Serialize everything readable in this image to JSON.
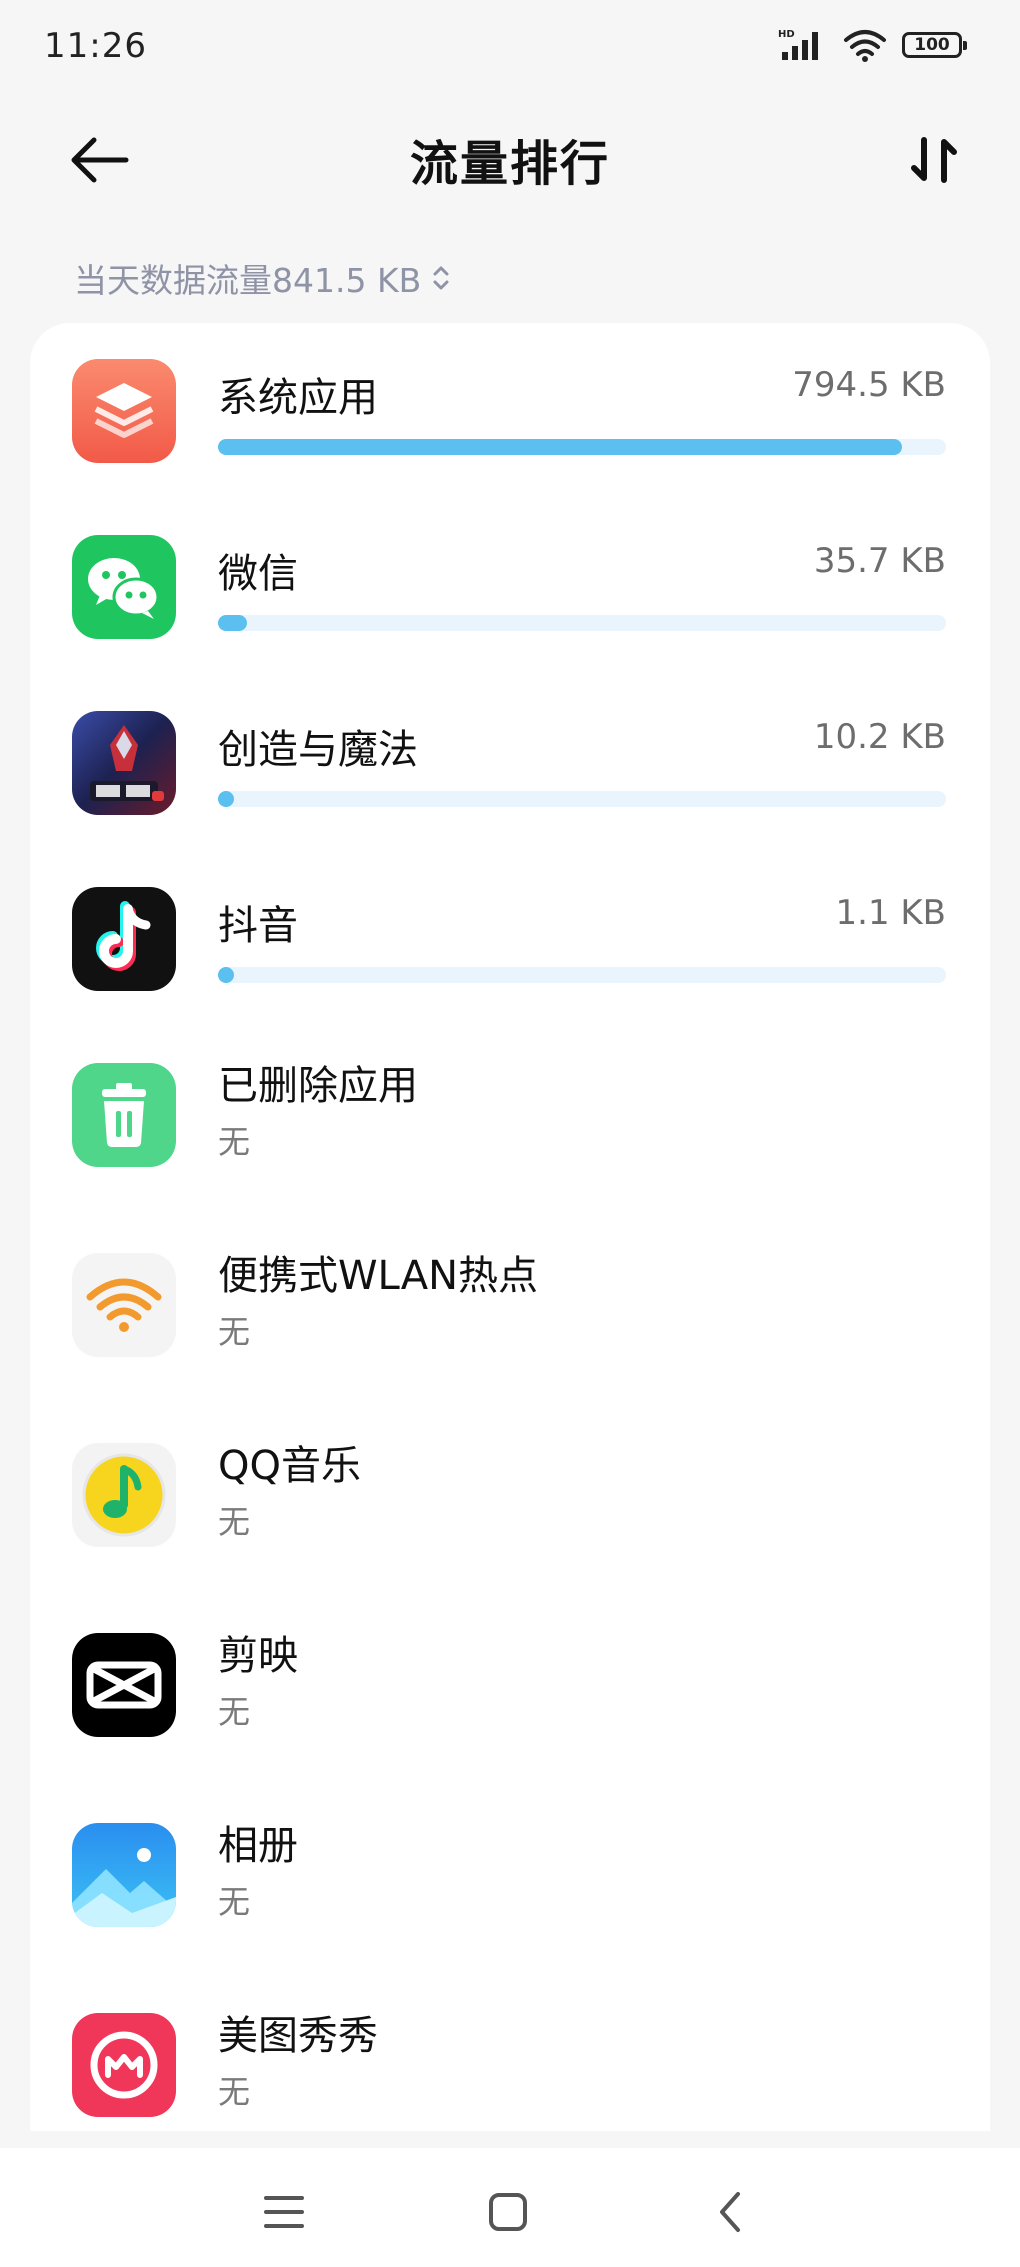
{
  "status_bar": {
    "time": "11:26",
    "battery": "100",
    "network": "HD"
  },
  "header": {
    "title": "流量排行"
  },
  "summary": {
    "label": "当天数据流量841.5 KB"
  },
  "apps": [
    {
      "name": "系统应用",
      "size": "794.5 KB",
      "usage_fraction": 0.94,
      "icon": "system-apps-icon",
      "color": "#f46a54"
    },
    {
      "name": "微信",
      "size": "35.7 KB",
      "usage_fraction": 0.04,
      "icon": "wechat-icon",
      "color": "#1fc660"
    },
    {
      "name": "创造与魔法",
      "size": "10.2 KB",
      "usage_fraction": 0.012,
      "icon": "game-icon",
      "color": "#2a2f6e"
    },
    {
      "name": "抖音",
      "size": "1.1 KB",
      "usage_fraction": 0.001,
      "icon": "douyin-icon",
      "color": "#111111"
    },
    {
      "name": "已删除应用",
      "sub": "无",
      "icon": "trash-icon",
      "color": "#4fd68a"
    },
    {
      "name": "便携式WLAN热点",
      "sub": "无",
      "icon": "wifi-hotspot-icon",
      "color": "#f5f5f5"
    },
    {
      "name": "QQ音乐",
      "sub": "无",
      "icon": "qq-music-icon",
      "color": "#f7d51f"
    },
    {
      "name": "剪映",
      "sub": "无",
      "icon": "capcut-icon",
      "color": "#000000"
    },
    {
      "name": "相册",
      "sub": "无",
      "icon": "gallery-icon",
      "color": "#2aa2f0"
    },
    {
      "name": "美图秀秀",
      "sub": "无",
      "icon": "meitu-icon",
      "color": "#f0375a"
    }
  ],
  "colors": {
    "accent": "#5bc0f0",
    "track": "#e9f4fc",
    "background": "#f6f6f6"
  }
}
